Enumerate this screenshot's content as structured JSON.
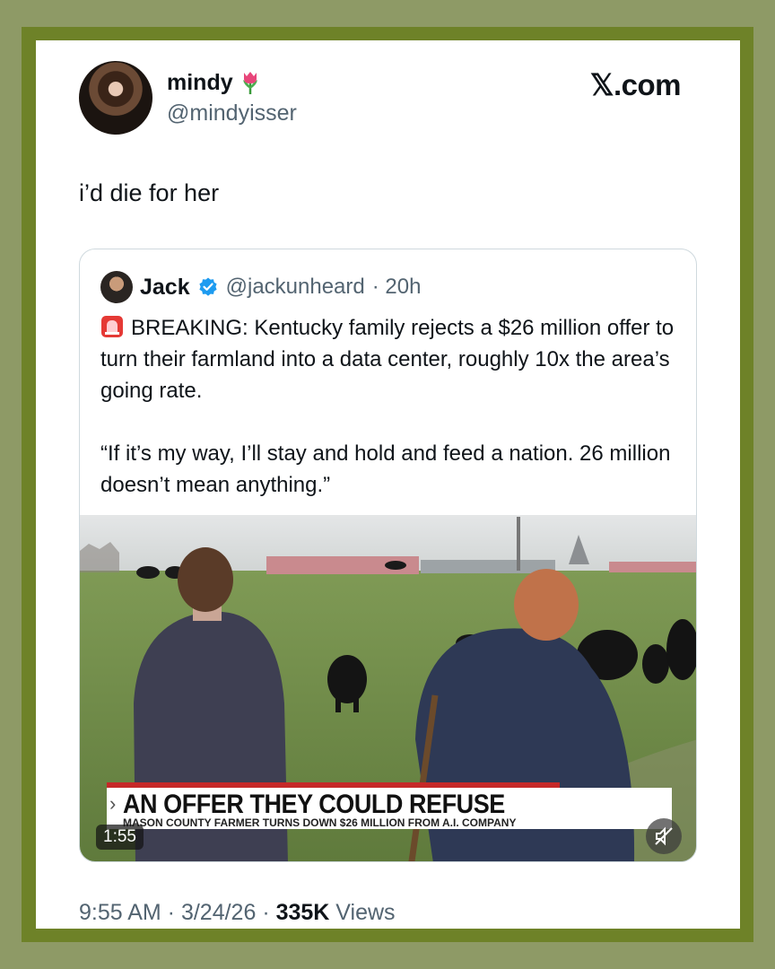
{
  "author": {
    "name": "mindy",
    "handle": "@mindyisser",
    "emoji_icon": "tulip-icon",
    "avatar_icon": "avatar-photo"
  },
  "brand": "𝕏.com",
  "tweet": {
    "text": "i’d die for her"
  },
  "quote": {
    "name": "Jack",
    "handle": "@jackunheard",
    "time": "· 20h",
    "paragraph1": "BREAKING: Kentucky family rejects a $26 million offer to turn their farmland into a data center, roughly 10x the area’s going rate.",
    "paragraph2": "“If it’s my way, I’ll stay and hold and feed a nation. 26 million doesn’t mean anything.”",
    "video": {
      "headline": "AN OFFER THEY COULD REFUSE",
      "arrow": "›",
      "subhead": "MASON COUNTY FARMER TURNS DOWN $26 MILLION FROM A.I. COMPANY",
      "duration": "1:55",
      "mute_icon": "muted-speaker-icon"
    }
  },
  "footer": {
    "time": "9:55 AM",
    "sep1": " · ",
    "date": "3/24/26",
    "sep2": " · ",
    "views_count": "335K",
    "views_label": " Views"
  },
  "colors": {
    "background": "#8e9a66",
    "frame": "#6e8228",
    "verified_blue": "#1d9bf0",
    "secondary_text": "#536471"
  }
}
